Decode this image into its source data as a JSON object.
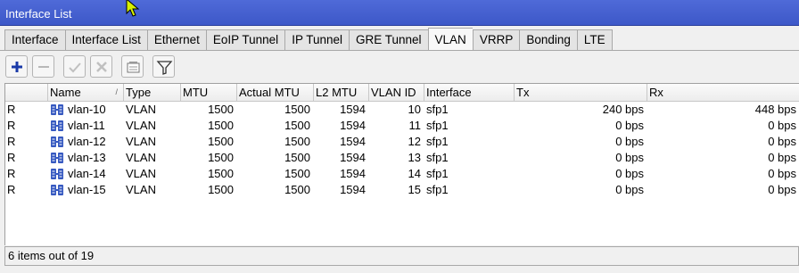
{
  "window": {
    "title": "Interface List"
  },
  "tabs": [
    {
      "label": "Interface",
      "active": false
    },
    {
      "label": "Interface List",
      "active": false
    },
    {
      "label": "Ethernet",
      "active": false
    },
    {
      "label": "EoIP Tunnel",
      "active": false
    },
    {
      "label": "IP Tunnel",
      "active": false
    },
    {
      "label": "GRE Tunnel",
      "active": false
    },
    {
      "label": "VLAN",
      "active": true
    },
    {
      "label": "VRRP",
      "active": false
    },
    {
      "label": "Bonding",
      "active": false
    },
    {
      "label": "LTE",
      "active": false
    }
  ],
  "toolbar": {
    "buttons": [
      {
        "name": "add-button",
        "icon": "plus-icon",
        "enabled": true
      },
      {
        "name": "remove-button",
        "icon": "minus-icon",
        "enabled": false
      },
      {
        "name": "enable-button",
        "icon": "check-icon",
        "enabled": false
      },
      {
        "name": "disable-button",
        "icon": "x-icon",
        "enabled": false
      },
      {
        "name": "comment-button",
        "icon": "note-icon",
        "enabled": true
      },
      {
        "name": "filter-button",
        "icon": "filter-icon",
        "enabled": true
      }
    ]
  },
  "table": {
    "columns": [
      "",
      "Name",
      "Type",
      "MTU",
      "Actual MTU",
      "L2 MTU",
      "VLAN ID",
      "Interface",
      "Tx",
      "Rx"
    ],
    "rows": [
      {
        "flag": "R",
        "name": "vlan-10",
        "type": "VLAN",
        "mtu": "1500",
        "actual_mtu": "1500",
        "l2_mtu": "1594",
        "vlan_id": "10",
        "interface": "sfp1",
        "tx": "240 bps",
        "rx": "448 bps"
      },
      {
        "flag": "R",
        "name": "vlan-11",
        "type": "VLAN",
        "mtu": "1500",
        "actual_mtu": "1500",
        "l2_mtu": "1594",
        "vlan_id": "11",
        "interface": "sfp1",
        "tx": "0 bps",
        "rx": "0 bps"
      },
      {
        "flag": "R",
        "name": "vlan-12",
        "type": "VLAN",
        "mtu": "1500",
        "actual_mtu": "1500",
        "l2_mtu": "1594",
        "vlan_id": "12",
        "interface": "sfp1",
        "tx": "0 bps",
        "rx": "0 bps"
      },
      {
        "flag": "R",
        "name": "vlan-13",
        "type": "VLAN",
        "mtu": "1500",
        "actual_mtu": "1500",
        "l2_mtu": "1594",
        "vlan_id": "13",
        "interface": "sfp1",
        "tx": "0 bps",
        "rx": "0 bps"
      },
      {
        "flag": "R",
        "name": "vlan-14",
        "type": "VLAN",
        "mtu": "1500",
        "actual_mtu": "1500",
        "l2_mtu": "1594",
        "vlan_id": "14",
        "interface": "sfp1",
        "tx": "0 bps",
        "rx": "0 bps"
      },
      {
        "flag": "R",
        "name": "vlan-15",
        "type": "VLAN",
        "mtu": "1500",
        "actual_mtu": "1500",
        "l2_mtu": "1594",
        "vlan_id": "15",
        "interface": "sfp1",
        "tx": "0 bps",
        "rx": "0 bps"
      }
    ]
  },
  "status": {
    "text": "6 items out of 19"
  },
  "colors": {
    "titlebar": "#4560d0",
    "add": "#1a3aa8"
  }
}
